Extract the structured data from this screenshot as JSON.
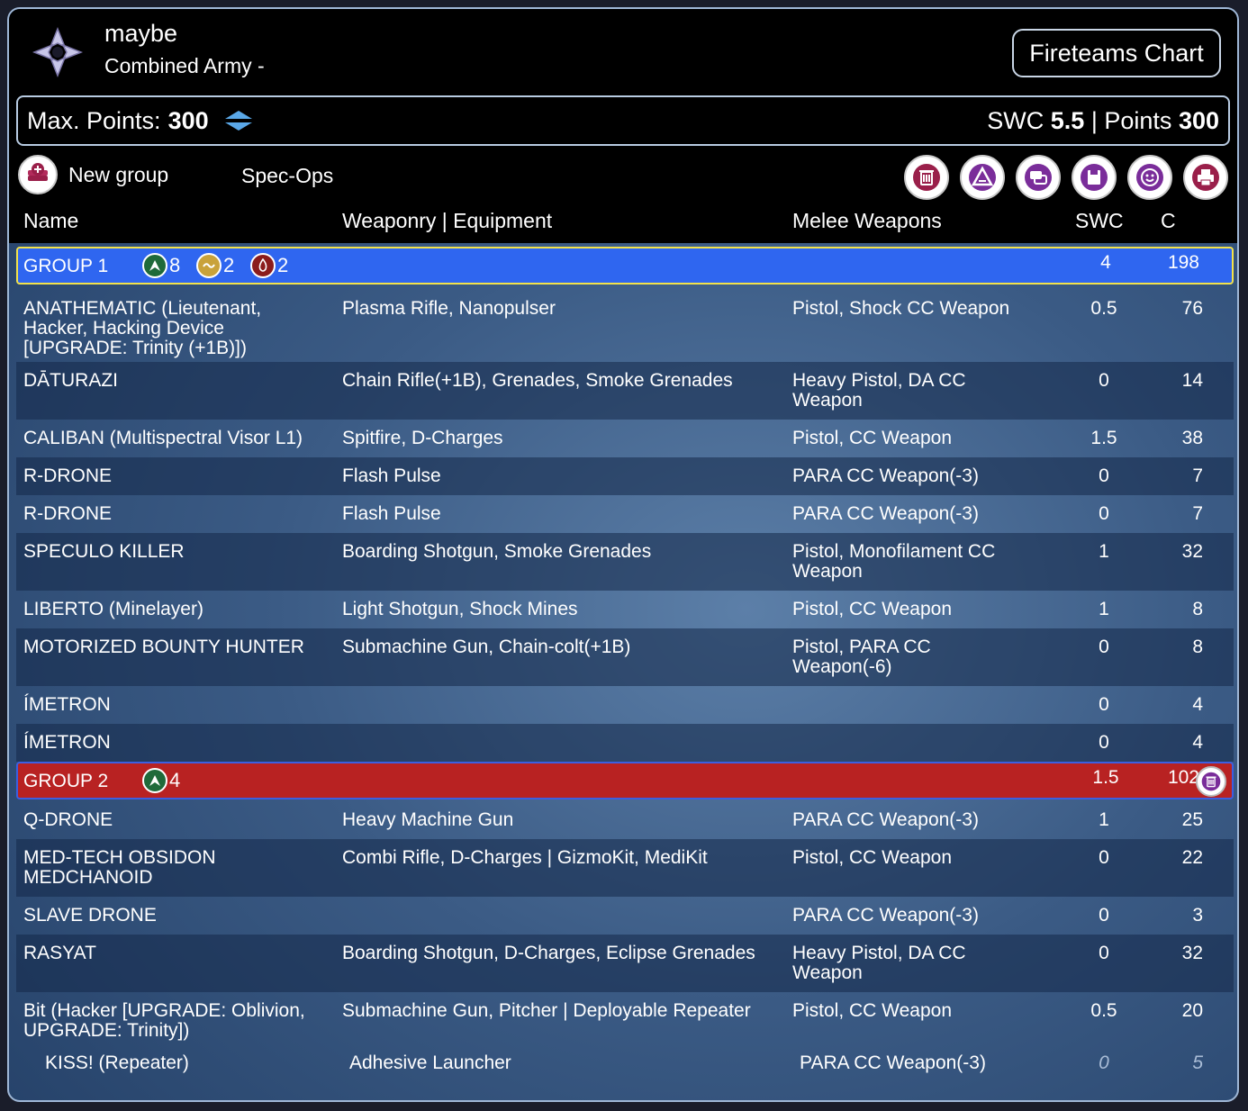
{
  "header": {
    "army_name": "maybe",
    "army_subtitle": "Combined Army -",
    "fireteams_button": "Fireteams Chart"
  },
  "points_bar": {
    "max_points_label": "Max. Points:",
    "max_points_value": "300",
    "swc_label": "SWC",
    "swc_value": "5.5",
    "separator": "|",
    "points_label": "Points",
    "points_value": "300"
  },
  "toolbar": {
    "new_group_label": "New group",
    "spec_ops_label": "Spec-Ops",
    "icons": [
      "trash-icon",
      "lieutenant-icon",
      "chat-icon",
      "save-icon",
      "smiley-icon",
      "print-icon"
    ]
  },
  "columns": {
    "name": "Name",
    "weaponry": "Weaponry | Equipment",
    "melee": "Melee Weapons",
    "swc": "SWC",
    "c": "C"
  },
  "group1": {
    "label": "GROUP 1",
    "regular": "8",
    "irregular": "2",
    "impetuous": "2",
    "swc": "4",
    "c": "198",
    "rows": [
      {
        "name": "ANATHEMATIC (Lieutenant, Hacker, Hacking Device [UPGRADE: Trinity (+1B)])",
        "weap": "Plasma Rifle, Nanopulser",
        "melee": "Pistol, Shock CC Weapon",
        "swc": "0.5",
        "c": "76"
      },
      {
        "name": "DĀTURAZI",
        "weap": "Chain Rifle(+1B), Grenades, Smoke Grenades",
        "melee": "Heavy Pistol, DA CC Weapon",
        "swc": "0",
        "c": "14"
      },
      {
        "name": "CALIBAN (Multispectral Visor L1)",
        "weap": "Spitfire, D-Charges",
        "melee": "Pistol, CC Weapon",
        "swc": "1.5",
        "c": "38"
      },
      {
        "name": "R-DRONE",
        "weap": "Flash Pulse",
        "melee": "PARA CC Weapon(-3)",
        "swc": "0",
        "c": "7"
      },
      {
        "name": "R-DRONE",
        "weap": "Flash Pulse",
        "melee": "PARA CC Weapon(-3)",
        "swc": "0",
        "c": "7"
      },
      {
        "name": "SPECULO KILLER",
        "weap": "Boarding Shotgun, Smoke Grenades",
        "melee": "Pistol, Monofilament CC Weapon",
        "swc": "1",
        "c": "32"
      },
      {
        "name": "LIBERTO (Minelayer)",
        "weap": "Light Shotgun, Shock Mines",
        "melee": "Pistol, CC Weapon",
        "swc": "1",
        "c": "8"
      },
      {
        "name": "MOTORIZED BOUNTY HUNTER",
        "weap": "Submachine Gun, Chain-colt(+1B)",
        "melee": "Pistol, PARA CC Weapon(-6)",
        "swc": "0",
        "c": "8"
      },
      {
        "name": "ÍMETRON",
        "weap": "",
        "melee": "",
        "swc": "0",
        "c": "4"
      },
      {
        "name": "ÍMETRON",
        "weap": "",
        "melee": "",
        "swc": "0",
        "c": "4"
      }
    ]
  },
  "group2": {
    "label": "GROUP 2",
    "regular": "4",
    "swc": "1.5",
    "c": "102",
    "rows": [
      {
        "name": "Q-DRONE",
        "weap": "Heavy Machine Gun",
        "melee": "PARA CC Weapon(-3)",
        "swc": "1",
        "c": "25"
      },
      {
        "name": "MED-TECH OBSIDON MEDCHANOID",
        "weap": "Combi Rifle, D-Charges | GizmoKit, MediKit",
        "melee": "Pistol, CC Weapon",
        "swc": "0",
        "c": "22"
      },
      {
        "name": "SLAVE DRONE",
        "weap": "",
        "melee": "PARA CC Weapon(-3)",
        "swc": "0",
        "c": "3"
      },
      {
        "name": "RASYAT",
        "weap": "Boarding Shotgun, D-Charges, Eclipse Grenades",
        "melee": "Heavy Pistol, DA CC Weapon",
        "swc": "0",
        "c": "32"
      },
      {
        "name": "Bit (Hacker [UPGRADE: Oblivion, UPGRADE: Trinity])",
        "weap": "Submachine Gun, Pitcher | Deployable Repeater",
        "melee": "Pistol, CC Weapon",
        "swc": "0.5",
        "c": "20"
      },
      {
        "name": "KISS! (Repeater)",
        "weap": "Adhesive Launcher",
        "melee": "PARA CC Weapon(-3)",
        "swc": "0",
        "c": "5"
      }
    ]
  }
}
